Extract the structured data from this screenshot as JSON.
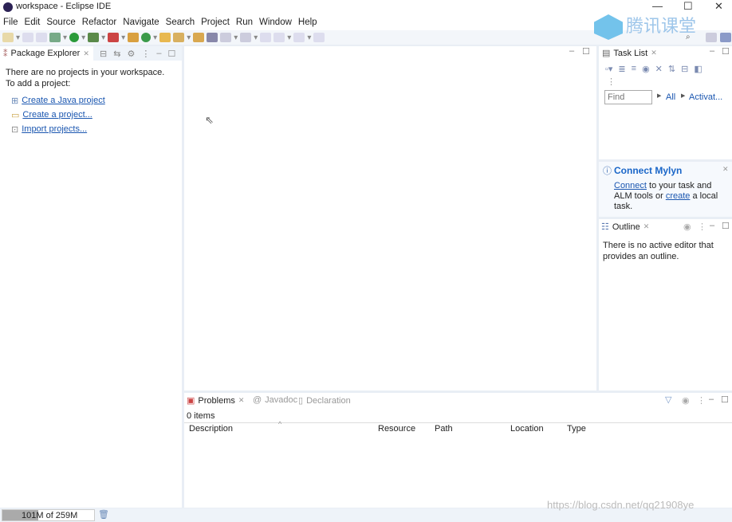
{
  "window": {
    "title": "workspace - Eclipse IDE"
  },
  "menu": [
    "File",
    "Edit",
    "Source",
    "Refactor",
    "Navigate",
    "Search",
    "Project",
    "Run",
    "Window",
    "Help"
  ],
  "package_explorer": {
    "tab": "Package Explorer",
    "message1": "There are no projects in your workspace.",
    "message2": "To add a project:",
    "links": [
      "Create a Java project",
      "Create a project...",
      "Import projects..."
    ]
  },
  "task_list": {
    "tab": "Task List",
    "find_placeholder": "Find",
    "filter_all": "All",
    "filter_activate": "Activat..."
  },
  "mylyn": {
    "title": "Connect Mylyn",
    "connect": "Connect",
    "text1": " to your task and",
    "text2": "ALM tools or ",
    "create": "create",
    "text3": " a local",
    "text4": "task."
  },
  "outline": {
    "tab": "Outline",
    "message": "There is no active editor that provides an outline."
  },
  "problems": {
    "tabs": [
      "Problems",
      "Javadoc",
      "Declaration"
    ],
    "count": "0 items",
    "columns": [
      "Description",
      "Resource",
      "Path",
      "Location",
      "Type"
    ]
  },
  "status": {
    "memory": "101M of 259M",
    "memory_used_fraction": 0.39
  },
  "watermarks": {
    "tencent": "腾讯课堂",
    "url": "https://blog.csdn.net/qq21908ye"
  }
}
